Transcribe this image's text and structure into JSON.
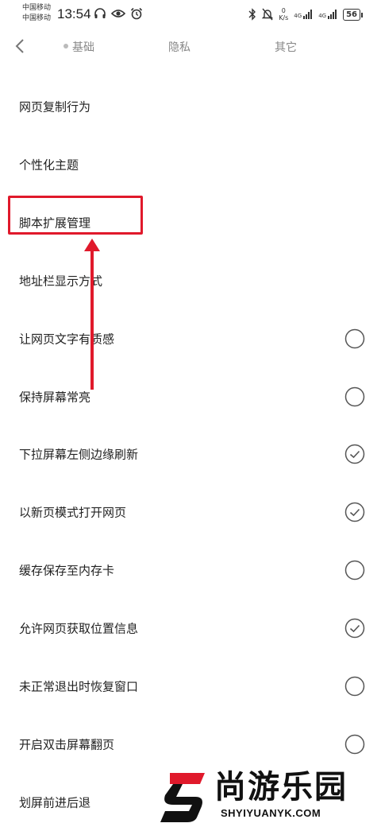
{
  "status_bar": {
    "carrier_1": "中国移动",
    "carrier_2": "中国移动",
    "time": "13:54",
    "net_speed_value": "0",
    "net_speed_unit": "K/s",
    "signal_1_label": "4G",
    "signal_2_label": "4G",
    "battery": "56",
    "icons": [
      "headphones-icon",
      "eye-icon",
      "alarm-icon",
      "bluetooth-icon",
      "mute-icon",
      "wifi-icon"
    ]
  },
  "tabs": [
    {
      "label": "基础",
      "active": true
    },
    {
      "label": "隐私",
      "active": false
    },
    {
      "label": "其它",
      "active": false
    }
  ],
  "settings": [
    {
      "label": "网页复制行为",
      "toggle": null
    },
    {
      "label": "个性化主题",
      "toggle": null
    },
    {
      "label": "脚本扩展管理",
      "toggle": null,
      "highlighted": true
    },
    {
      "label": "地址栏显示方式",
      "toggle": null
    },
    {
      "label": "让网页文字有质感",
      "toggle": false
    },
    {
      "label": "保持屏幕常亮",
      "toggle": false
    },
    {
      "label": "下拉屏幕左侧边缘刷新",
      "toggle": true
    },
    {
      "label": "以新页模式打开网页",
      "toggle": true
    },
    {
      "label": "缓存保存至内存卡",
      "toggle": false
    },
    {
      "label": "允许网页获取位置信息",
      "toggle": true
    },
    {
      "label": "未正常退出时恢复窗口",
      "toggle": false
    },
    {
      "label": "开启双击屏幕翻页",
      "toggle": false
    },
    {
      "label": "划屏前进后退",
      "toggle": null
    }
  ],
  "watermark": {
    "cn": "尚游乐园",
    "en": "SHYIYUANYK.COM"
  },
  "colors": {
    "annotation": "#e0192b",
    "toggle_border": "#555555",
    "tab_text": "#888888"
  }
}
